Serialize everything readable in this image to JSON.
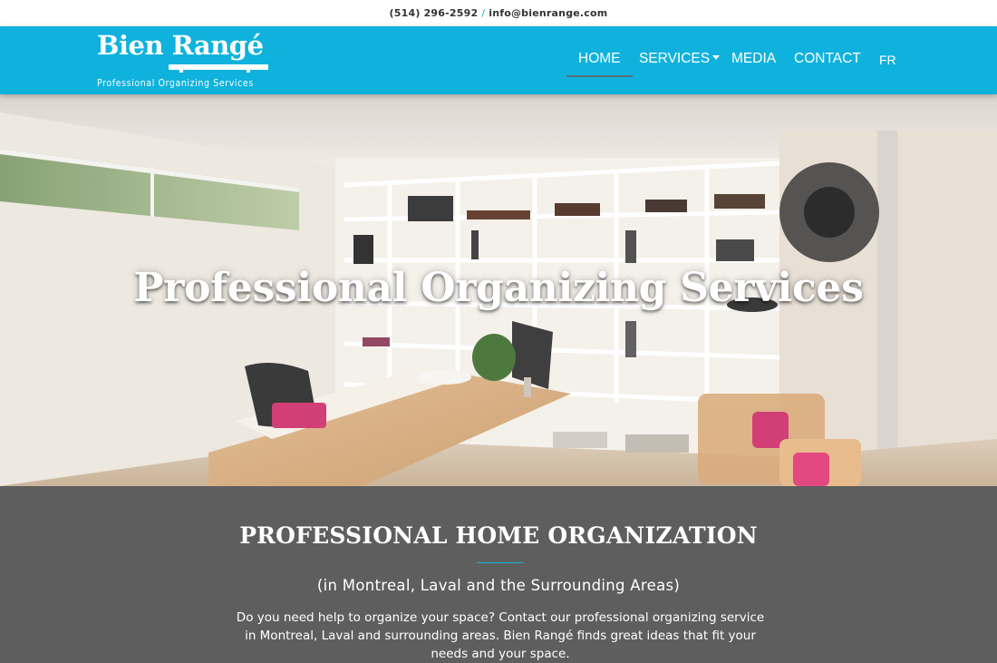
{
  "topbar": {
    "phone": "(514) 296-2592",
    "separator": "/",
    "email": "info@bienrange.com"
  },
  "logo": {
    "title": "Bien Rangé",
    "subtitle": "Professional Organizing Services"
  },
  "nav": {
    "items": [
      {
        "label": "HOME",
        "active": true
      },
      {
        "label": "SERVICES",
        "dropdown": true
      },
      {
        "label": "MEDIA"
      },
      {
        "label": "CONTACT"
      },
      {
        "label": "FR"
      }
    ]
  },
  "hero": {
    "title": "Professional Organizing Services"
  },
  "section": {
    "heading": "PROFESSIONAL HOME ORGANIZATION",
    "subheading": "(in Montreal, Laval and the Surrounding Areas)",
    "body": "Do you need help to organize your space? Contact our professional organizing service in Montreal, Laval and surrounding areas. Bien Rangé finds great ideas that fit your needs and your space."
  },
  "colors": {
    "brand": "#0fb2dd",
    "section_bg": "#5e5e5e",
    "accent": "#17b0d8"
  }
}
